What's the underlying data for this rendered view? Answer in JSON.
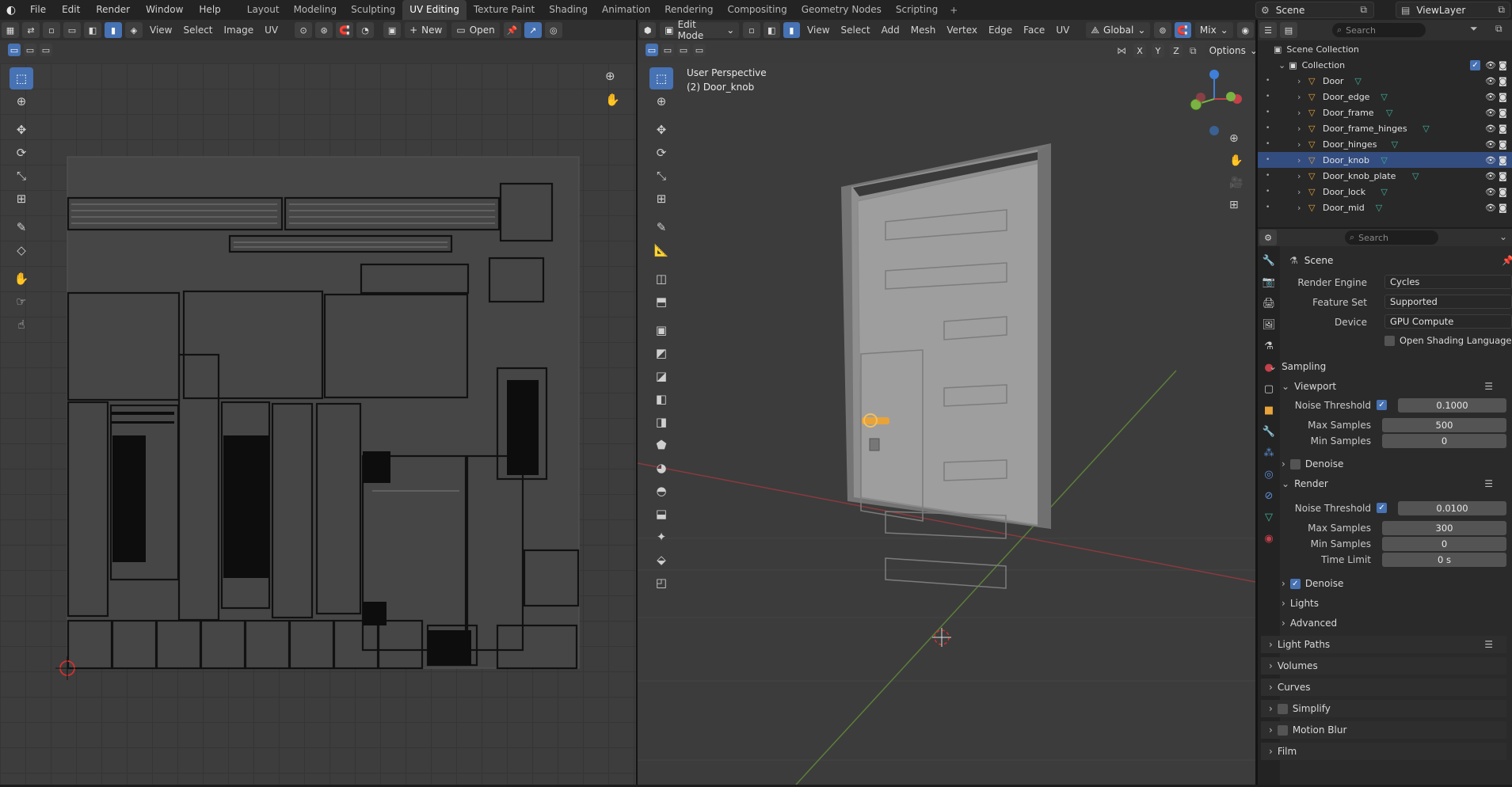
{
  "topbar": {
    "menus": [
      "File",
      "Edit",
      "Render",
      "Window",
      "Help"
    ],
    "workspaces": [
      "Layout",
      "Modeling",
      "Sculpting",
      "UV Editing",
      "Texture Paint",
      "Shading",
      "Animation",
      "Rendering",
      "Compositing",
      "Geometry Nodes",
      "Scripting"
    ],
    "active_workspace": "UV Editing",
    "scene": "Scene",
    "view_layer": "ViewLayer"
  },
  "uv_editor": {
    "menus": [
      "View",
      "Select",
      "Image",
      "UV"
    ],
    "new_label": "New",
    "open_label": "Open"
  },
  "viewport": {
    "mode": "Edit Mode",
    "menus": [
      "View",
      "Select",
      "Add",
      "Mesh",
      "Vertex",
      "Edge",
      "Face",
      "UV"
    ],
    "orientation": "Global",
    "shading": "Mix",
    "options_label": "Options",
    "axis_buttons": [
      "X",
      "Y",
      "Z"
    ],
    "overlay_title": "User Perspective",
    "overlay_object": "(2) Door_knob"
  },
  "outliner": {
    "search_placeholder": "Search",
    "scene_collection": "Scene Collection",
    "collection": "Collection",
    "objects": [
      "Door",
      "Door_edge",
      "Door_frame",
      "Door_frame_hinges",
      "Door_hinges",
      "Door_knob",
      "Door_knob_plate",
      "Door_lock",
      "Door_mid"
    ],
    "selected": "Door_knob"
  },
  "properties": {
    "search_placeholder": "Search",
    "context": "Scene",
    "render_engine_label": "Render Engine",
    "render_engine": "Cycles",
    "feature_set_label": "Feature Set",
    "feature_set": "Supported",
    "device_label": "Device",
    "device": "GPU Compute",
    "osl_label": "Open Shading Language",
    "sampling": "Sampling",
    "viewport": "Viewport",
    "noise_threshold_label": "Noise Threshold",
    "viewport_noise": "0.1000",
    "max_samples_label": "Max Samples",
    "viewport_max": "500",
    "min_samples_label": "Min Samples",
    "viewport_min": "0",
    "denoise_label": "Denoise",
    "render": "Render",
    "render_noise": "0.0100",
    "render_max": "300",
    "render_min": "0",
    "time_limit_label": "Time Limit",
    "time_limit": "0 s",
    "lights": "Lights",
    "advanced": "Advanced",
    "light_paths": "Light Paths",
    "volumes": "Volumes",
    "curves": "Curves",
    "simplify": "Simplify",
    "motion_blur": "Motion Blur",
    "film": "Film"
  },
  "colors": {
    "accent": "#4772b3",
    "selected_row": "#334d80",
    "x_axis": "#c2414a",
    "y_axis": "#7ab343",
    "z_axis": "#3f7fd9",
    "knob": "#e8a33a"
  }
}
